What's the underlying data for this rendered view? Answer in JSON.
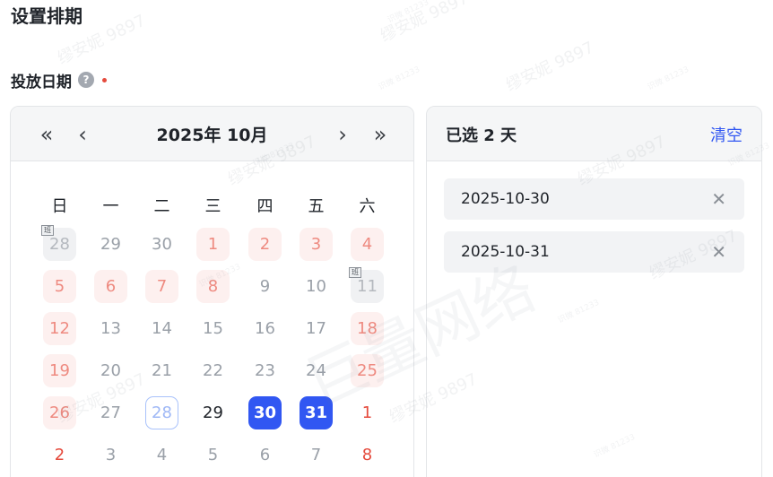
{
  "page": {
    "title": "设置排期",
    "field_label": "投放日期",
    "help_icon": "?"
  },
  "colors": {
    "primary": "#3157f2",
    "holiday_bg": "#fdf0ef",
    "holiday_text": "#ee8a80",
    "required": "#e54a3c"
  },
  "calendar": {
    "title": "2025年 10月",
    "nav": {
      "prev_year_icon": "«",
      "prev_month_icon": "‹",
      "next_month_icon": "›",
      "next_year_icon": "»"
    },
    "weekdays": [
      "日",
      "一",
      "二",
      "三",
      "四",
      "五",
      "六"
    ],
    "weeks": [
      [
        {
          "label": "28",
          "state": "other",
          "badge": "班"
        },
        {
          "label": "29",
          "state": "muted"
        },
        {
          "label": "30",
          "state": "muted"
        },
        {
          "label": "1",
          "state": "holiday"
        },
        {
          "label": "2",
          "state": "holiday"
        },
        {
          "label": "3",
          "state": "holiday"
        },
        {
          "label": "4",
          "state": "holiday"
        }
      ],
      [
        {
          "label": "5",
          "state": "holiday"
        },
        {
          "label": "6",
          "state": "holiday"
        },
        {
          "label": "7",
          "state": "holiday"
        },
        {
          "label": "8",
          "state": "holiday"
        },
        {
          "label": "9",
          "state": "muted"
        },
        {
          "label": "10",
          "state": "muted"
        },
        {
          "label": "11",
          "state": "other",
          "badge": "班"
        }
      ],
      [
        {
          "label": "12",
          "state": "holiday"
        },
        {
          "label": "13",
          "state": "muted"
        },
        {
          "label": "14",
          "state": "muted"
        },
        {
          "label": "15",
          "state": "muted"
        },
        {
          "label": "16",
          "state": "muted"
        },
        {
          "label": "17",
          "state": "muted"
        },
        {
          "label": "18",
          "state": "holiday"
        }
      ],
      [
        {
          "label": "19",
          "state": "holiday"
        },
        {
          "label": "20",
          "state": "muted"
        },
        {
          "label": "21",
          "state": "muted"
        },
        {
          "label": "22",
          "state": "muted"
        },
        {
          "label": "23",
          "state": "muted"
        },
        {
          "label": "24",
          "state": "muted"
        },
        {
          "label": "25",
          "state": "holiday"
        }
      ],
      [
        {
          "label": "26",
          "state": "holiday"
        },
        {
          "label": "27",
          "state": "muted"
        },
        {
          "label": "28",
          "state": "today"
        },
        {
          "label": "29",
          "state": "avail"
        },
        {
          "label": "30",
          "state": "selected"
        },
        {
          "label": "31",
          "state": "selected"
        },
        {
          "label": "1",
          "state": "holiday-text"
        }
      ],
      [
        {
          "label": "2",
          "state": "holiday-text"
        },
        {
          "label": "3",
          "state": "muted"
        },
        {
          "label": "4",
          "state": "muted"
        },
        {
          "label": "5",
          "state": "muted"
        },
        {
          "label": "6",
          "state": "muted"
        },
        {
          "label": "7",
          "state": "muted"
        },
        {
          "label": "8",
          "state": "holiday-text"
        }
      ]
    ]
  },
  "selection": {
    "title": "已选 2 天",
    "clear_label": "清空",
    "close_icon": "✕",
    "dates": [
      "2025-10-30",
      "2025-10-31"
    ]
  },
  "watermark": {
    "name": "缪安妮 9897",
    "code": "识微 81233",
    "large": "巨量网络"
  }
}
